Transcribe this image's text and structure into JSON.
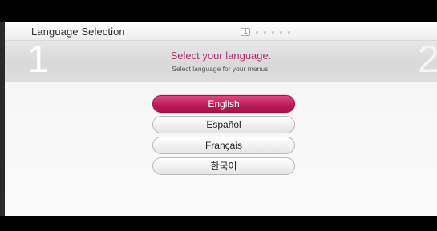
{
  "header": {
    "title": "Language Selection",
    "current_page": "1",
    "total_dots": 5
  },
  "step": {
    "current": "1",
    "next": "2"
  },
  "prompt": {
    "heading": "Select your language.",
    "subheading": "Select language for your menus."
  },
  "languages": [
    {
      "label": "English",
      "selected": true
    },
    {
      "label": "Español",
      "selected": false
    },
    {
      "label": "Français",
      "selected": false
    },
    {
      "label": "한국어",
      "selected": false
    }
  ],
  "colors": {
    "accent": "#b81a55",
    "heading": "#b0306a"
  }
}
